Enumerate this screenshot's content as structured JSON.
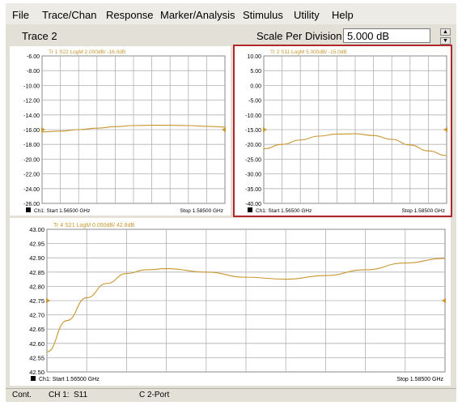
{
  "menu": [
    "File",
    "Trace/Chan",
    "Response",
    "Marker/Analysis",
    "Stimulus",
    "Utility",
    "Help"
  ],
  "toolbar": {
    "active_trace": "Trace 2",
    "scale_label": "Scale Per Division",
    "scale_value": "5.000 dB"
  },
  "status": {
    "mode": "Cont.",
    "channel": "CH 1:",
    "param": "S11",
    "port": "C  2-Port"
  },
  "colors": {
    "trace": "#c8962e",
    "active_border": "#b02828",
    "grid": "#b0b0b0"
  },
  "chart_data": [
    {
      "type": "line",
      "title": "Tr 1  S22 LogM 2.000dB/ -16.0dB",
      "start_label": "Ch1: Start  1.56500 GHz",
      "stop_label": "Stop  1.58500 GHz",
      "ylim": [
        -26,
        -6
      ],
      "yticks": [
        "-6.00",
        "-8.00",
        "-10.00",
        "-12.00",
        "-14.00",
        "-16.00",
        "-18.00",
        "-20.00",
        "-22.00",
        "-24.00",
        "-26.00"
      ],
      "xlim": [
        1.565,
        1.585
      ],
      "reference": -16.0,
      "series": [
        {
          "x": [
            1.565,
            1.567,
            1.569,
            1.571,
            1.573,
            1.575,
            1.577,
            1.579,
            1.581,
            1.583,
            1.585
          ],
          "values": [
            -16.3,
            -16.2,
            -16.0,
            -15.8,
            -15.6,
            -15.45,
            -15.4,
            -15.4,
            -15.45,
            -15.55,
            -15.65
          ]
        }
      ]
    },
    {
      "type": "line",
      "title": "Tr 2  S11 LogM 5.000dB/ -15.0dB",
      "active": true,
      "start_label": "Ch1: Start  1.56500 GHz",
      "stop_label": "Stop  1.58500 GHz",
      "ylim": [
        -40,
        10
      ],
      "yticks": [
        "10.00",
        "5.00",
        "0.00",
        "-5.00",
        "-10.00",
        "-15.00",
        "-20.00",
        "-25.00",
        "-30.00",
        "-35.00",
        "-40.00"
      ],
      "xlim": [
        1.565,
        1.585
      ],
      "reference": -15.0,
      "series": [
        {
          "x": [
            1.565,
            1.567,
            1.569,
            1.571,
            1.573,
            1.575,
            1.577,
            1.579,
            1.581,
            1.583,
            1.585
          ],
          "values": [
            -21.5,
            -20.0,
            -18.5,
            -17.2,
            -16.5,
            -16.4,
            -17.0,
            -18.3,
            -20.2,
            -22.2,
            -23.8
          ]
        }
      ]
    },
    {
      "type": "line",
      "title": "Tr 4  S21 LogM 0.050dB/ 42.8dB",
      "start_label": "Ch1: Start  1.56500 GHz",
      "stop_label": "Stop  1.58500 GHz",
      "ylim": [
        42.5,
        43.0
      ],
      "yticks": [
        "43.00",
        "42.95",
        "42.90",
        "42.85",
        "42.80",
        "42.75",
        "42.70",
        "42.65",
        "42.60",
        "42.55",
        "42.50"
      ],
      "xlim": [
        1.565,
        1.585
      ],
      "reference": 42.75,
      "series": [
        {
          "x": [
            1.565,
            1.566,
            1.567,
            1.568,
            1.569,
            1.57,
            1.571,
            1.573,
            1.575,
            1.577,
            1.579,
            1.581,
            1.583,
            1.585
          ],
          "values": [
            42.57,
            42.68,
            42.76,
            42.81,
            42.845,
            42.858,
            42.862,
            42.85,
            42.832,
            42.825,
            42.838,
            42.858,
            42.882,
            42.898
          ]
        }
      ]
    }
  ]
}
